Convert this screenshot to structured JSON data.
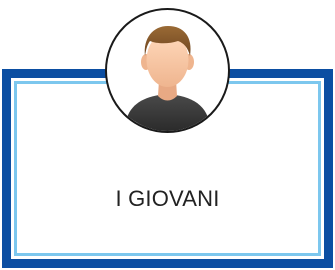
{
  "card": {
    "title": "I GIOVANI"
  },
  "avatar": {
    "icon": "person-avatar-icon"
  },
  "colors": {
    "frame_blue": "#0b4ea2",
    "inner_light_blue": "#7cc7ee",
    "skin": "#f4c6a2",
    "hair": "#8a5a2b",
    "shirt": "#3b3b3b"
  }
}
